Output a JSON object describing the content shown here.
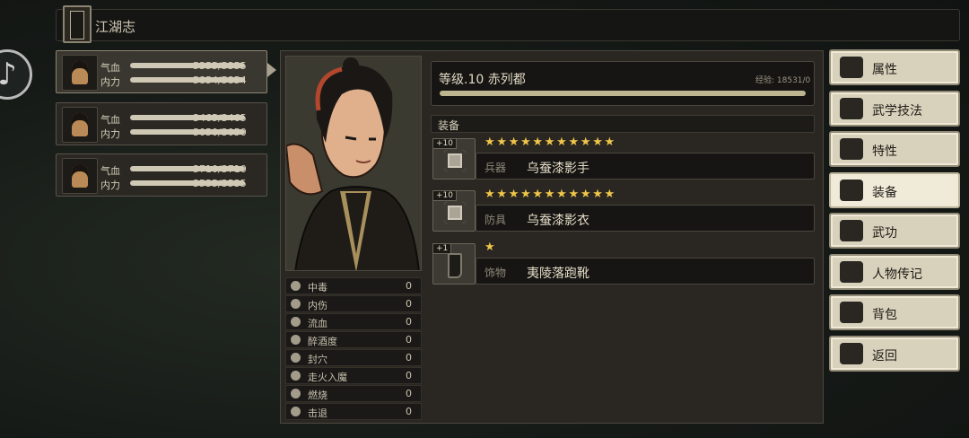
{
  "header": {
    "title": "江湖志"
  },
  "party": [
    {
      "hp_label": "气血",
      "hp": "5355/5355",
      "hp_pct": 1.0,
      "mp_label": "内力",
      "mp": "5854/5854",
      "mp_pct": 1.0
    },
    {
      "hp_label": "气血",
      "hp": "3465/3465",
      "hp_pct": 1.0,
      "mp_label": "内力",
      "mp": "3050/3050",
      "mp_pct": 1.0
    },
    {
      "hp_label": "气血",
      "hp": "3710/3710",
      "hp_pct": 1.0,
      "mp_label": "内力",
      "mp": "3535/3535",
      "mp_pct": 1.0
    }
  ],
  "character": {
    "level_name": "等级.10 赤列都",
    "exp": "经验: 18531/0",
    "exp_fill": 1.0
  },
  "status_effects": [
    {
      "name": "中毒",
      "value": "0"
    },
    {
      "name": "内伤",
      "value": "0"
    },
    {
      "name": "流血",
      "value": "0"
    },
    {
      "name": "醉酒度",
      "value": "0"
    },
    {
      "name": "封穴",
      "value": "0"
    },
    {
      "name": "走火入魔",
      "value": "0"
    },
    {
      "name": "燃烧",
      "value": "0"
    },
    {
      "name": "击退",
      "value": "0"
    }
  ],
  "equipment": {
    "title": "装备",
    "items": [
      {
        "level": "+10",
        "stars": "★★★★★★★★★★★",
        "type": "兵器",
        "name": "乌蚕漆影手",
        "icon": "gauntlet-icon"
      },
      {
        "level": "+10",
        "stars": "★★★★★★★★★★★",
        "type": "防具",
        "name": "乌蚕漆影衣",
        "icon": "armor-icon"
      },
      {
        "level": "+1",
        "stars": "★",
        "type": "饰物",
        "name": "夷陵落跑靴",
        "icon": "boot-icon"
      }
    ]
  },
  "menu": [
    {
      "label": "属性",
      "icon": "person-icon",
      "active": false
    },
    {
      "label": "武学技法",
      "icon": "martial-icon",
      "active": false
    },
    {
      "label": "特性",
      "icon": "trait-icon",
      "active": false
    },
    {
      "label": "装备",
      "icon": "sword-icon",
      "active": true
    },
    {
      "label": "武功",
      "icon": "manual-icon",
      "active": false
    },
    {
      "label": "人物传记",
      "icon": "scroll-icon",
      "active": false
    },
    {
      "label": "背包",
      "icon": "bag-icon",
      "active": false
    },
    {
      "label": "返回",
      "icon": "door-icon",
      "active": false
    }
  ],
  "colors": {
    "accent": "#f0c64a",
    "panel": "#2a2722",
    "button": "#d8d1bb"
  }
}
